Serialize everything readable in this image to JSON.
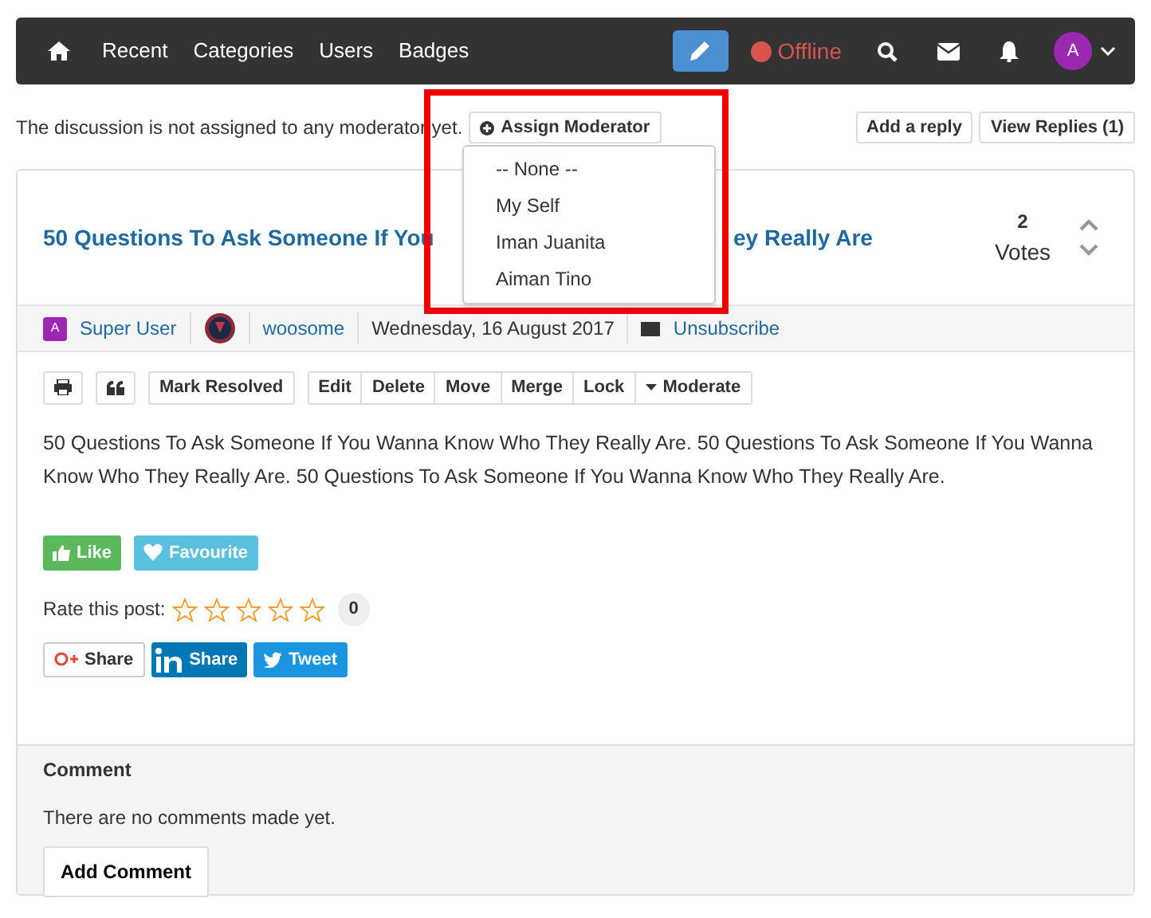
{
  "navbar": {
    "links": [
      {
        "label": "Recent"
      },
      {
        "label": "Categories"
      },
      {
        "label": "Users"
      },
      {
        "label": "Badges"
      }
    ],
    "status": "Offline",
    "avatar_letter": "A"
  },
  "assign_bar": {
    "message": "The discussion is not assigned to any moderator yet.",
    "assign_button": "Assign Moderator",
    "actions": [
      "Add a reply",
      "View Replies (1)"
    ]
  },
  "moderator_menu": {
    "options": [
      {
        "label": "-- None --"
      },
      {
        "label": "My Self"
      },
      {
        "label": "Iman Juanita"
      },
      {
        "label": "Aiman Tino"
      }
    ]
  },
  "topic": {
    "title_start": "50 Questions To Ask Someone If You",
    "title_end": "ey Really Are",
    "votes": "2",
    "votes_label": "Votes",
    "meta": {
      "author_letter": "A",
      "author": "Super User",
      "user": "woosome",
      "date": "Wednesday, 16 August 2017",
      "subscribe": "Unsubscribe"
    },
    "tools": [
      "Mark Resolved"
    ],
    "mod_tools": [
      "Edit",
      "Delete",
      "Move",
      "Merge",
      "Lock",
      "Moderate"
    ],
    "body": "50 Questions To Ask Someone If You Wanna Know Who They Really Are. 50 Questions To Ask Someone If You Wanna Know Who They Really Are. 50 Questions To Ask Someone If You Wanna Know Who They Really Are.",
    "like": "Like",
    "favourite": "Favourite",
    "rating": {
      "label": "Rate this post:",
      "stars": 0,
      "count": "0"
    },
    "share": [
      {
        "kind": "google",
        "label": "Share"
      },
      {
        "kind": "linkedin",
        "label": "Share"
      },
      {
        "kind": "twitter",
        "label": "Tweet"
      }
    ]
  },
  "comments": {
    "heading": "Comment",
    "empty": "There are no comments made yet.",
    "button": "Add Comment"
  }
}
